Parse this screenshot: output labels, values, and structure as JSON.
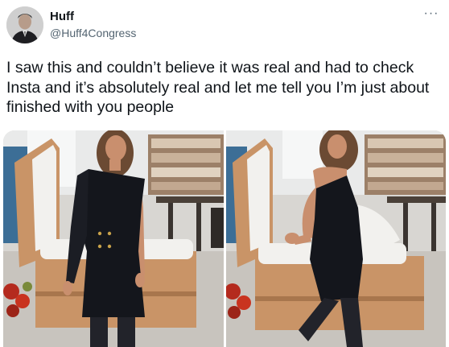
{
  "author": {
    "display_name": "Huff",
    "handle": "@Huff4Congress",
    "avatar_icon": "user-avatar-icon"
  },
  "more_icon": "ellipsis-icon",
  "more_glyph": "···",
  "tweet": {
    "text": "I saw this and couldn’t believe it was real and had to check Insta and it’s absolutely real and let me tell you I’m just about finished with you people"
  },
  "media": {
    "count": 2,
    "colors": {
      "floor": "#c8c4be",
      "shelf": "#a08870",
      "dress": "#14161c",
      "coffin_wood": "#c99467",
      "coffin_lining": "#f2f1ee",
      "flowers": "#b42a1e",
      "skin": "#c98f6e",
      "hair": "#6b4a33"
    }
  }
}
